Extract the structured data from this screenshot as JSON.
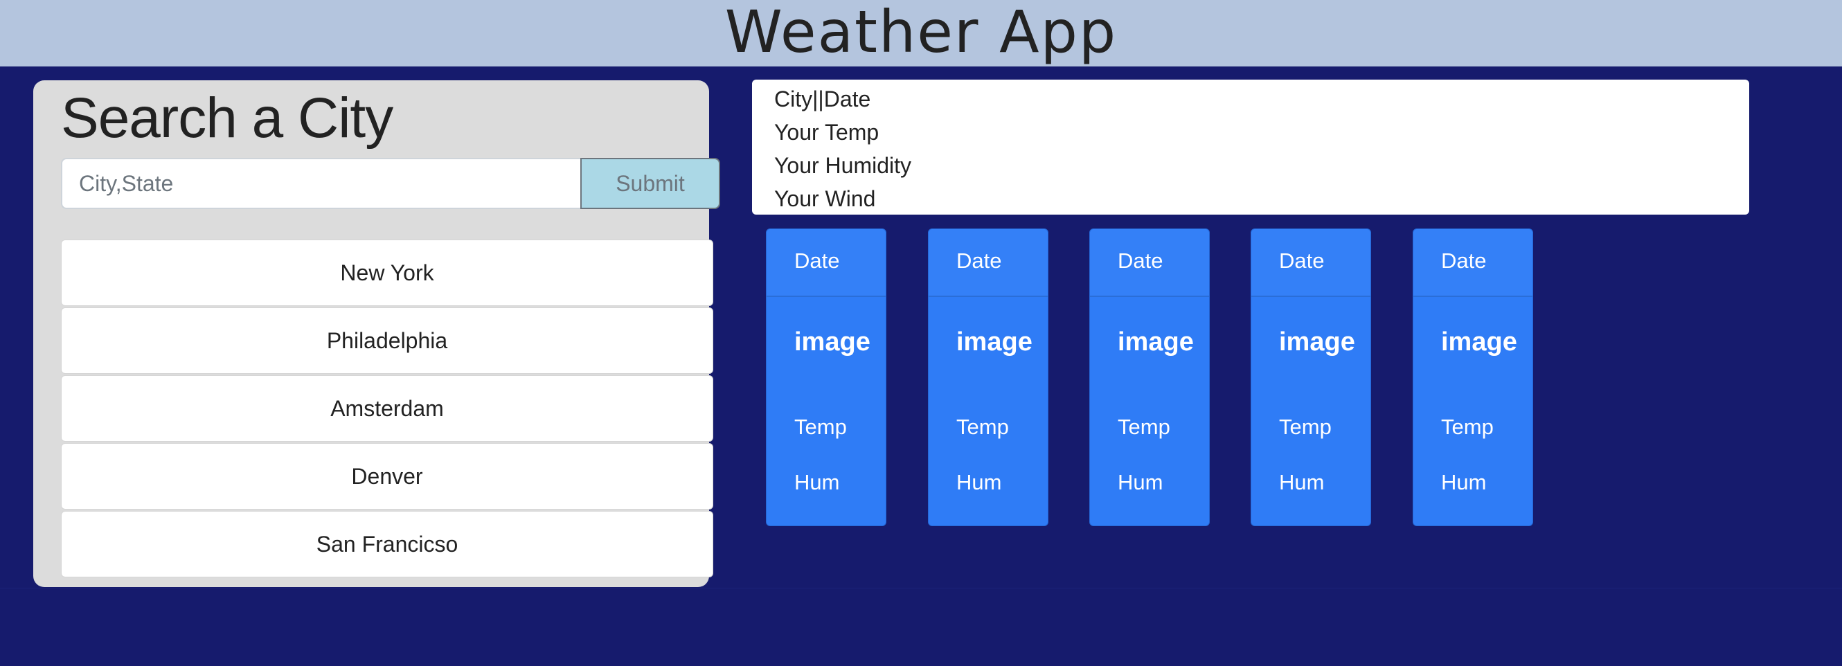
{
  "header": {
    "title": "Weather App"
  },
  "search": {
    "title": "Search a City",
    "placeholder": "City,State",
    "submit_label": "Submit",
    "cities": [
      "New York",
      "Philadelphia",
      "Amsterdam",
      "Denver",
      "San Francicso"
    ]
  },
  "current": {
    "city_date": "City||Date",
    "temp": "Your Temp",
    "humidity": "Your Humidity",
    "wind": "Your Wind"
  },
  "forecast": [
    {
      "date": "Date",
      "image": "image",
      "temp": "Temp",
      "hum": "Hum"
    },
    {
      "date": "Date",
      "image": "image",
      "temp": "Temp",
      "hum": "Hum"
    },
    {
      "date": "Date",
      "image": "image",
      "temp": "Temp",
      "hum": "Hum"
    },
    {
      "date": "Date",
      "image": "image",
      "temp": "Temp",
      "hum": "Hum"
    },
    {
      "date": "Date",
      "image": "image",
      "temp": "Temp",
      "hum": "Hum"
    }
  ],
  "colors": {
    "background": "#161b6d",
    "header_bg": "#b4c5de",
    "card_blue": "#2f7cf6",
    "submit_bg": "#abd8e6"
  }
}
